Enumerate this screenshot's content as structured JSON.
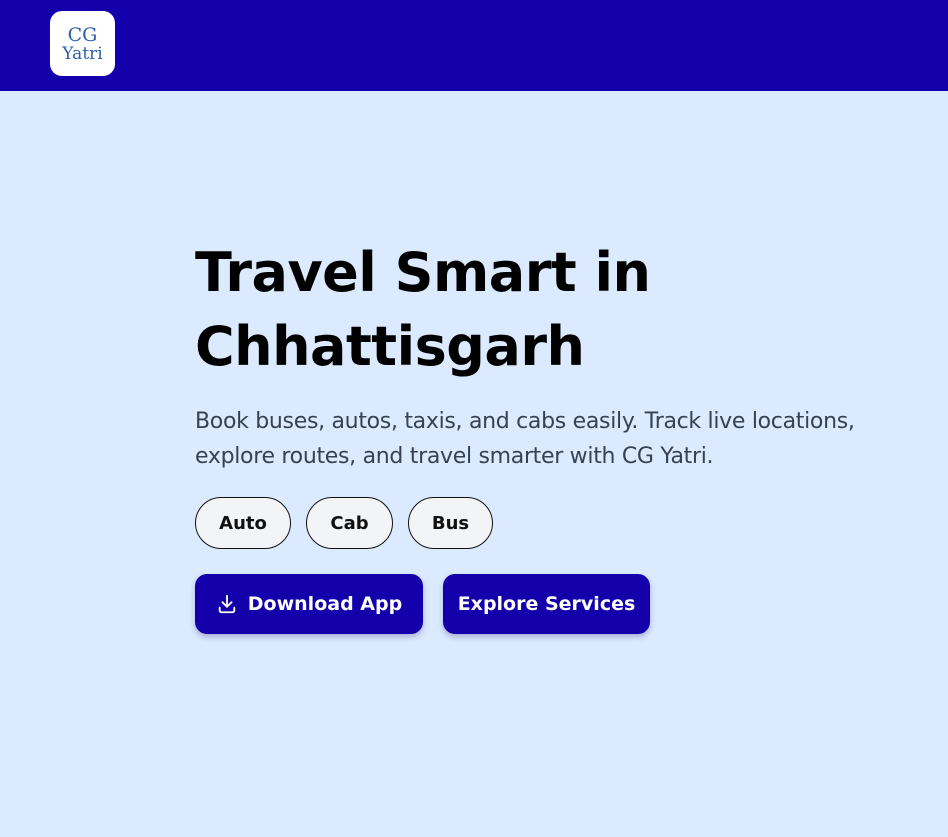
{
  "header": {
    "logo": {
      "line1": "CG",
      "line2": "Yatri"
    },
    "colors": {
      "background": "#1400aa"
    }
  },
  "hero": {
    "title_line1": "Travel Smart in",
    "title_line2": "Chhattisgarh",
    "subtitle": "Book buses, autos, taxis, and cabs easily. Track live locations, explore routes, and travel smarter with CG Yatri."
  },
  "chips": [
    {
      "label": "Auto"
    },
    {
      "label": "Cab"
    },
    {
      "label": "Bus"
    }
  ],
  "actions": {
    "download_label": "Download App",
    "download_icon": "download-icon",
    "explore_label": "Explore Services"
  },
  "colors": {
    "page_background": "#dbeafe",
    "accent": "#1400aa",
    "chip_background": "#f3f4f6"
  }
}
